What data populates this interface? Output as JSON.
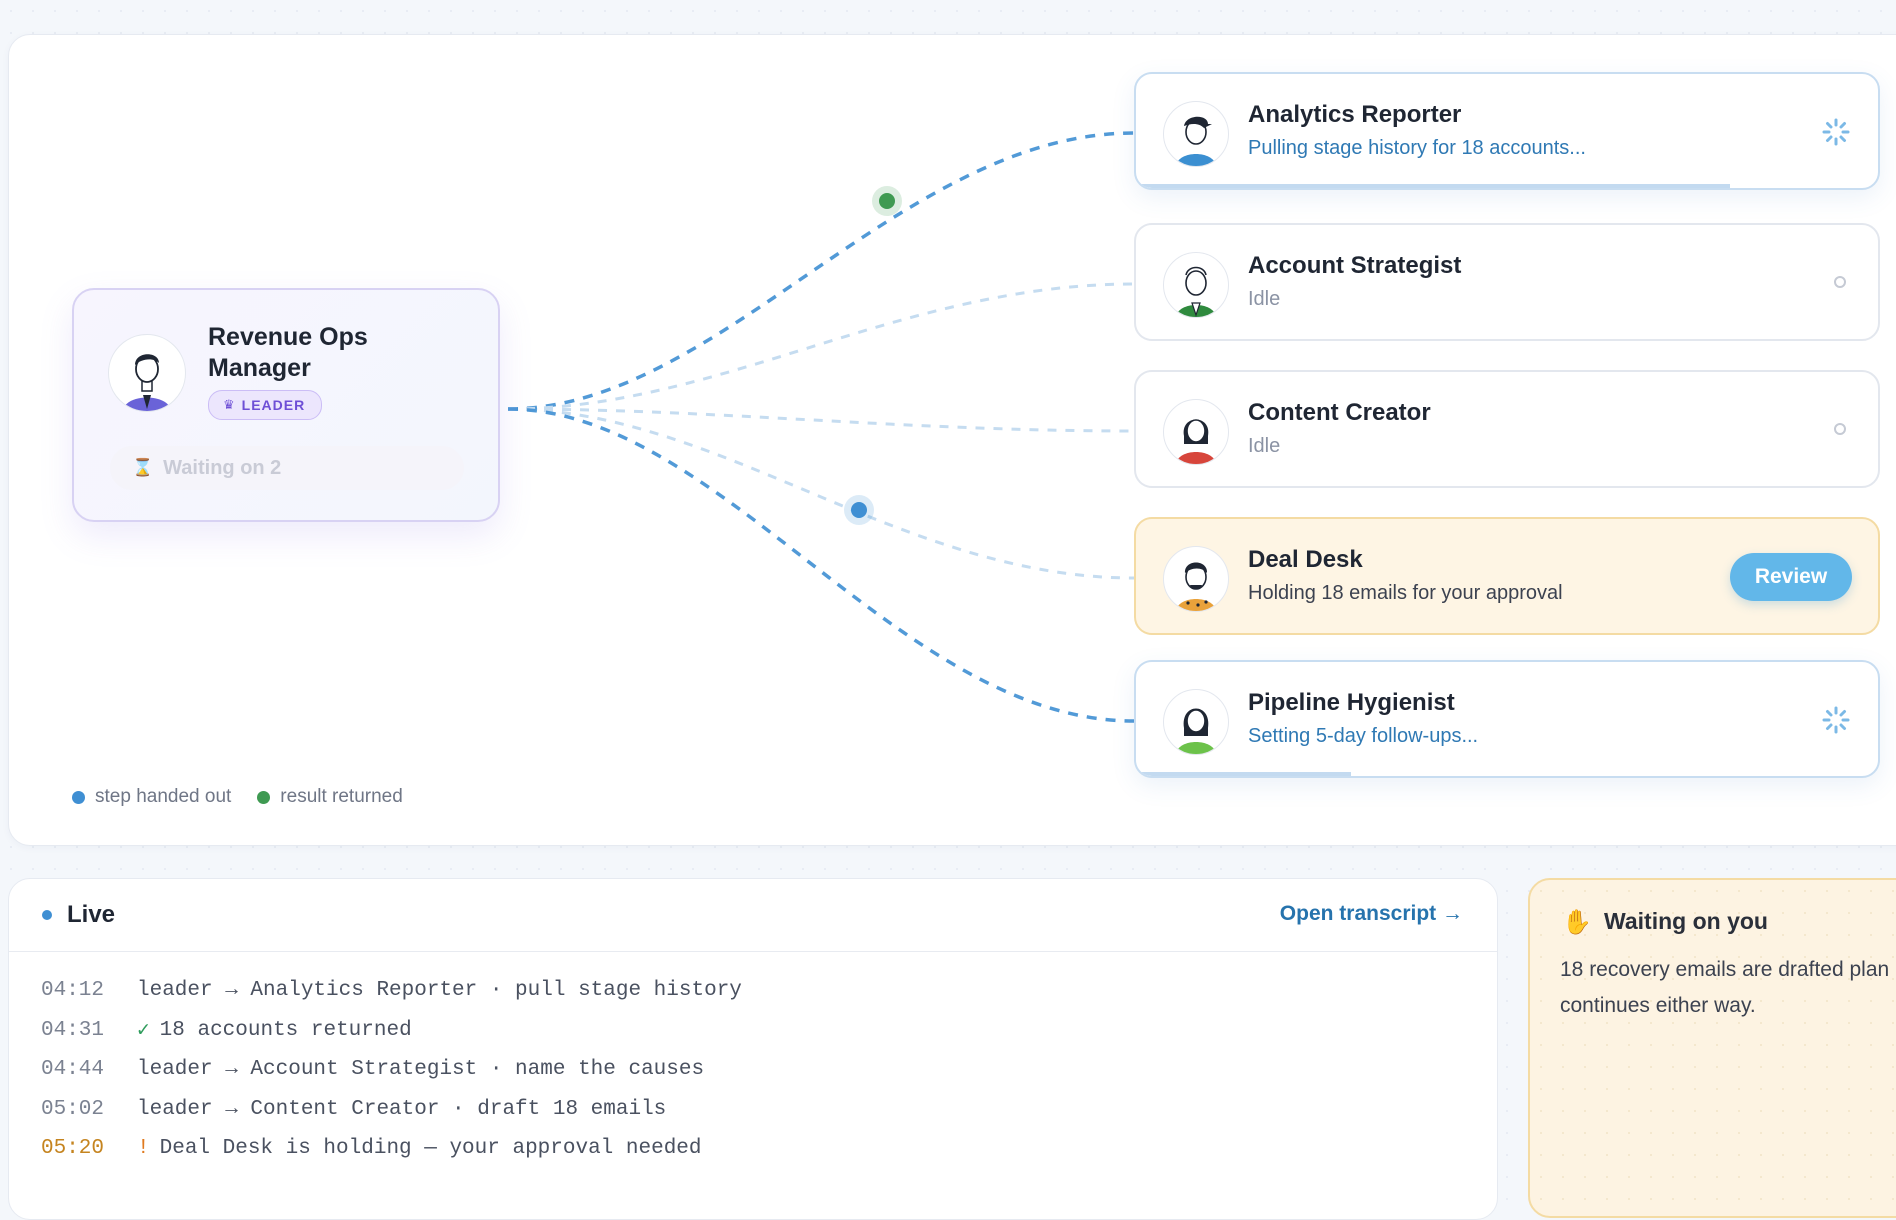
{
  "leader": {
    "name": "Revenue Ops Manager",
    "badge": "LEADER",
    "waiting": "Waiting on 2"
  },
  "agents": [
    {
      "name": "Analytics Reporter",
      "status": "Pulling stage history for 18 accounts...",
      "state": "working",
      "progress": 0.8
    },
    {
      "name": "Account Strategist",
      "status": "Idle",
      "state": "idle"
    },
    {
      "name": "Content Creator",
      "status": "Idle",
      "state": "idle"
    },
    {
      "name": "Deal Desk",
      "status": "Holding 18 emails for your approval",
      "state": "approval",
      "action": "Review"
    },
    {
      "name": "Pipeline Hygienist",
      "status": "Setting 5-day follow-ups...",
      "state": "working",
      "progress": 0.29
    }
  ],
  "legend": {
    "handed_out": "step handed out",
    "returned": "result returned"
  },
  "colors": {
    "handed_out": "#3f8fd3",
    "returned": "#3f9a52",
    "leader_accent": "#6e4fd6",
    "approval_bg": "#fef5e4",
    "review_button": "#62b7e9"
  },
  "live": {
    "title": "Live",
    "transcript_link": "Open transcript →",
    "log": [
      {
        "time": "04:12",
        "mark": "",
        "text": "leader → Analytics Reporter · pull stage history"
      },
      {
        "time": "04:31",
        "mark": "✓",
        "text": "18 accounts returned"
      },
      {
        "time": "04:44",
        "mark": "",
        "text": "leader → Account Strategist · name the causes"
      },
      {
        "time": "05:02",
        "mark": "",
        "text": "leader → Content Creator · draft 18 emails"
      },
      {
        "time": "05:20",
        "mark": "!",
        "text": "Deal Desk is holding — your approval needed"
      }
    ]
  },
  "waiting_panel": {
    "title": "Waiting on you",
    "text": "18 recovery emails are drafted plan continues either way."
  }
}
